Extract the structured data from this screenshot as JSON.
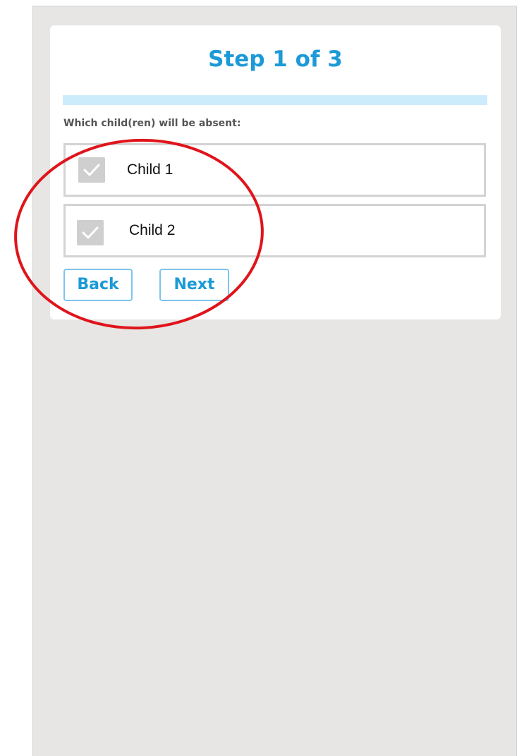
{
  "wizard": {
    "step_title": "Step 1 of 3",
    "progress": {
      "current_step": 1,
      "total_steps": 3
    },
    "question": "Which child(ren) will be absent:",
    "options": [
      {
        "label": "Child 1",
        "checked": false
      },
      {
        "label": "Child 2",
        "checked": false
      }
    ],
    "buttons": {
      "back_label": "Back",
      "next_label": "Next"
    }
  },
  "colors": {
    "accent": "#1b9ad7",
    "progress_track": "#cdecfb",
    "background": "#e7e6e4",
    "checkbox": "#cfcfcf",
    "annotation": "#e0141b"
  },
  "icons": {
    "checkbox": "check-icon"
  }
}
